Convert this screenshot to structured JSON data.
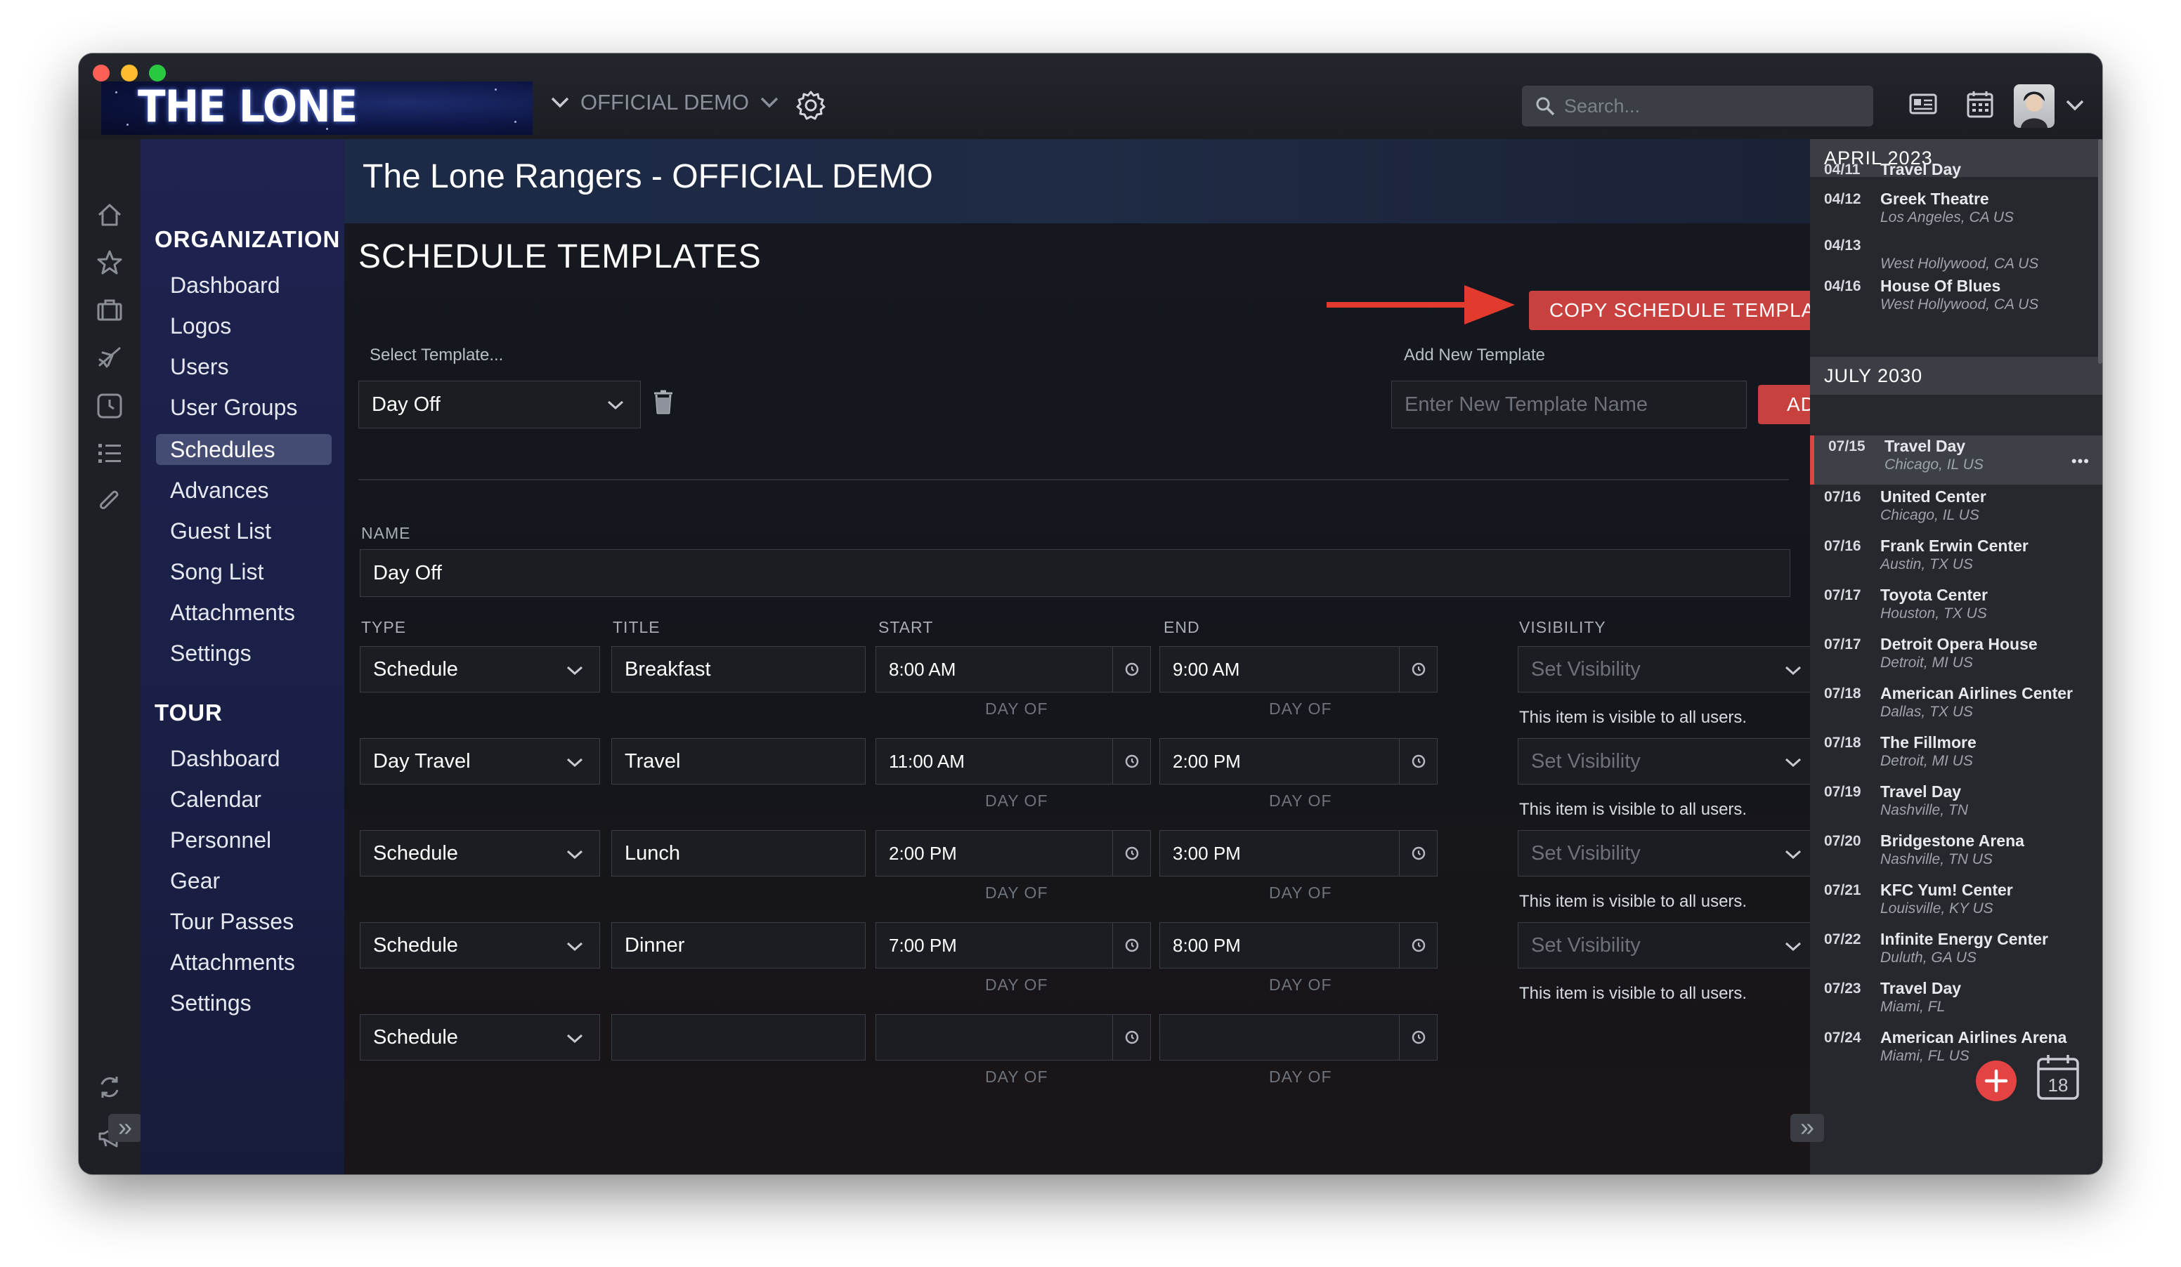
{
  "app": {
    "logo_text": "THE LONE RANGERS",
    "org_name": "OFFICIAL DEMO",
    "search_placeholder": "Search..."
  },
  "sidebar": {
    "org_heading": "ORGANIZATION",
    "org_items": [
      {
        "label": "Dashboard"
      },
      {
        "label": "Logos"
      },
      {
        "label": "Users"
      },
      {
        "label": "User Groups"
      },
      {
        "label": "Schedules",
        "active": true
      },
      {
        "label": "Advances"
      },
      {
        "label": "Guest List"
      },
      {
        "label": "Song List"
      },
      {
        "label": "Attachments"
      },
      {
        "label": "Settings"
      }
    ],
    "tour_heading": "TOUR",
    "tour_items": [
      {
        "label": "Dashboard"
      },
      {
        "label": "Calendar"
      },
      {
        "label": "Personnel"
      },
      {
        "label": "Gear"
      },
      {
        "label": "Tour Passes"
      },
      {
        "label": "Attachments"
      },
      {
        "label": "Settings"
      }
    ]
  },
  "main": {
    "page_title": "The Lone Rangers - OFFICIAL DEMO",
    "section_title": "SCHEDULE TEMPLATES",
    "copy_button": "COPY SCHEDULE TEMPLATE",
    "select_template_label": "Select Template...",
    "selected_template": "Day Off",
    "add_new_label": "Add New Template",
    "new_template_placeholder": "Enter New Template Name",
    "add_button": "ADD",
    "name_label": "NAME",
    "name_value": "Day Off",
    "columns": {
      "type": "TYPE",
      "title": "TITLE",
      "start": "START",
      "end": "END",
      "visibility": "VISIBILITY"
    },
    "day_of_label": "DAY OF",
    "visibility_placeholder": "Set Visibility",
    "visibility_note": "This item is visible to all users.",
    "rows": [
      {
        "type": "Schedule",
        "title": "Breakfast",
        "start": "8:00 AM",
        "end": "9:00 AM"
      },
      {
        "type": "Day Travel",
        "title": "Travel",
        "start": "11:00 AM",
        "end": "2:00 PM"
      },
      {
        "type": "Schedule",
        "title": "Lunch",
        "start": "2:00 PM",
        "end": "3:00 PM"
      },
      {
        "type": "Schedule",
        "title": "Dinner",
        "start": "7:00 PM",
        "end": "8:00 PM"
      },
      {
        "type": "Schedule",
        "title": "",
        "start": "",
        "end": ""
      }
    ]
  },
  "calendar_panel": {
    "months": [
      {
        "label": "APRIL 2023",
        "events": [
          {
            "date": "04/11",
            "title": "Travel Day",
            "location": ""
          },
          {
            "date": "04/12",
            "title": "Greek Theatre",
            "location": "Los Angeles, CA US"
          },
          {
            "date": "04/13",
            "title": "",
            "location": "West Hollywood, CA US"
          },
          {
            "date": "04/16",
            "title": "House Of Blues",
            "location": "West Hollywood, CA US"
          }
        ]
      },
      {
        "label": "JULY 2030",
        "events": [
          {
            "date": "07/15",
            "title": "Travel Day",
            "location": "Chicago, IL US",
            "selected": true,
            "more": "•••"
          },
          {
            "date": "07/16",
            "title": "United Center",
            "location": "Chicago, IL US"
          },
          {
            "date": "07/16",
            "title": "Frank Erwin Center",
            "location": "Austin, TX US"
          },
          {
            "date": "07/17",
            "title": "Toyota Center",
            "location": "Houston, TX US"
          },
          {
            "date": "07/17",
            "title": "Detroit Opera House",
            "location": "Detroit, MI US"
          },
          {
            "date": "07/18",
            "title": "American Airlines Center",
            "location": "Dallas, TX US"
          },
          {
            "date": "07/18",
            "title": "The Fillmore",
            "location": "Detroit, MI US"
          },
          {
            "date": "07/19",
            "title": "Travel Day",
            "location": "Nashville, TN"
          },
          {
            "date": "07/20",
            "title": "Bridgestone Arena",
            "location": "Nashville, TN US"
          },
          {
            "date": "07/21",
            "title": "KFC Yum! Center",
            "location": "Louisville, KY US"
          },
          {
            "date": "07/22",
            "title": "Infinite Energy Center",
            "location": "Duluth, GA US"
          },
          {
            "date": "07/23",
            "title": "Travel Day",
            "location": "Miami, FL"
          },
          {
            "date": "07/24",
            "title": "American Airlines Arena",
            "location": "Miami, FL US"
          }
        ]
      }
    ],
    "calendar_day": "18"
  },
  "icons": {
    "rail": [
      "home-icon",
      "star-icon",
      "briefcase-icon",
      "plane-icon",
      "clock-icon",
      "list-icon",
      "paperclip-icon"
    ],
    "accent_color": "#c9413f"
  }
}
